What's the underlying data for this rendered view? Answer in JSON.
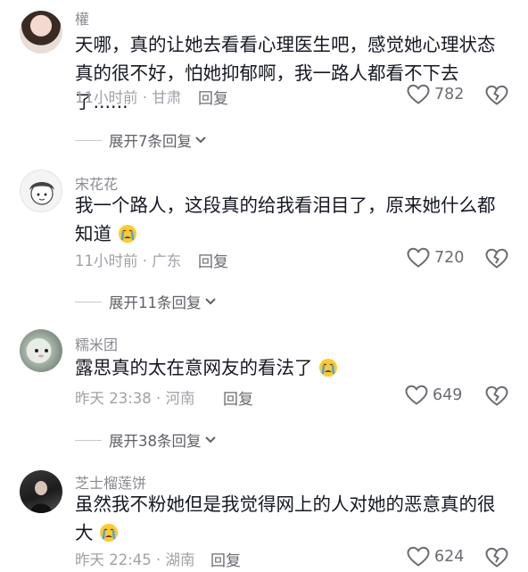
{
  "comments": [
    {
      "username": "權",
      "text": "天哪，真的让她去看看心理医生吧，感觉她心理状态真的很不好，怕她抑郁啊，我一路人都看不下去了......",
      "time_location": "11小时前 · 甘肃",
      "reply_label": "回复",
      "likes": "782",
      "expand_label": "展开7条回复"
    },
    {
      "username": "宋花花",
      "text": "我一个路人，这段真的给我看泪目了，原来她什么都知道",
      "time_location": "11小时前 · 广东",
      "reply_label": "回复",
      "likes": "720",
      "expand_label": "展开11条回复"
    },
    {
      "username": "糯米团",
      "text": "露思真的太在意网友的看法了",
      "time_location": "昨天 23:38 · 河南",
      "reply_label": "回复",
      "likes": "649",
      "expand_label": "展开38条回复"
    },
    {
      "username": "芝士榴莲饼",
      "text": "虽然我不粉她但是我觉得网上的人对她的恶意真的很大",
      "time_location": "昨天 22:45 · 湖南",
      "reply_label": "回复",
      "likes": "624"
    }
  ],
  "icons": {
    "like": "heart-outline-icon",
    "dislike": "broken-heart-icon",
    "expand": "chevron-down-icon",
    "emoji": "crying-face-emoji"
  },
  "colors": {
    "text": "#161823",
    "secondary": "#8a8b91",
    "meta": "#a0a1a7",
    "icon": "#6b6c72"
  }
}
